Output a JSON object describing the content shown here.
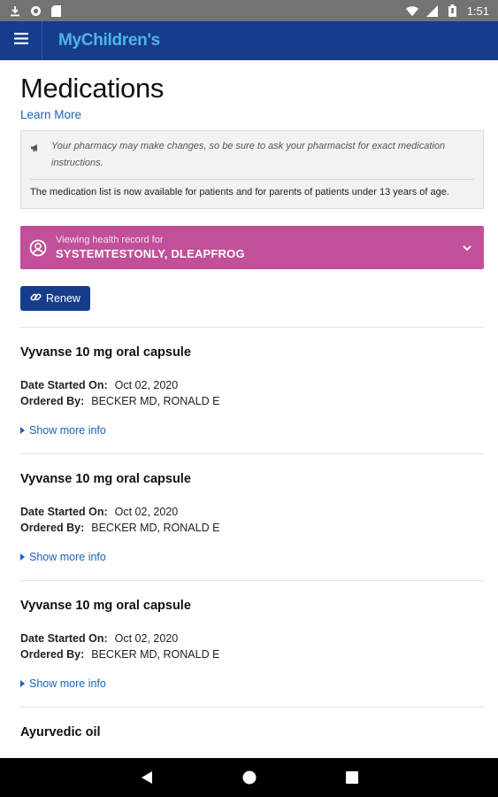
{
  "status_bar": {
    "time": "1:51",
    "left_icons": [
      "download-icon",
      "sync-icon",
      "sd-card-icon"
    ],
    "right_icons": [
      "wifi-icon",
      "signal-icon",
      "battery-icon"
    ]
  },
  "app_bar": {
    "logo_prefix": "My",
    "logo_suffix": "Children's",
    "color": "#163d8c",
    "logo_color": "#4fb3ea"
  },
  "page": {
    "title": "Medications",
    "learn_more": "Learn More"
  },
  "notice": {
    "italic_text": "Your pharmacy may make changes, so be sure to ask your pharmacist for exact medication instructions.",
    "plain_text": "The medication list is now available for patients and for parents of patients under 13 years of age."
  },
  "patient": {
    "label": "Viewing health record for",
    "name": "SYSTEMTESTONLY, DLEAPFROG",
    "color": "#c24f99"
  },
  "renew_button": "Renew",
  "medications": [
    {
      "name": "Vyvanse 10 mg oral capsule",
      "date_label": "Date Started On:",
      "date_value": "Oct 02, 2020",
      "ordered_label": "Ordered By:",
      "ordered_value": "BECKER MD, RONALD E",
      "show_more": "Show more info"
    },
    {
      "name": "Vyvanse 10 mg oral capsule",
      "date_label": "Date Started On:",
      "date_value": "Oct 02, 2020",
      "ordered_label": "Ordered By:",
      "ordered_value": "BECKER MD, RONALD E",
      "show_more": "Show more info"
    },
    {
      "name": "Vyvanse 10 mg oral capsule",
      "date_label": "Date Started On:",
      "date_value": "Oct 02, 2020",
      "ordered_label": "Ordered By:",
      "ordered_value": "BECKER MD, RONALD E",
      "show_more": "Show more info"
    },
    {
      "name": "Ayurvedic oil"
    }
  ],
  "nav_bar": {
    "buttons": [
      "back-icon",
      "home-icon",
      "recents-icon"
    ]
  }
}
